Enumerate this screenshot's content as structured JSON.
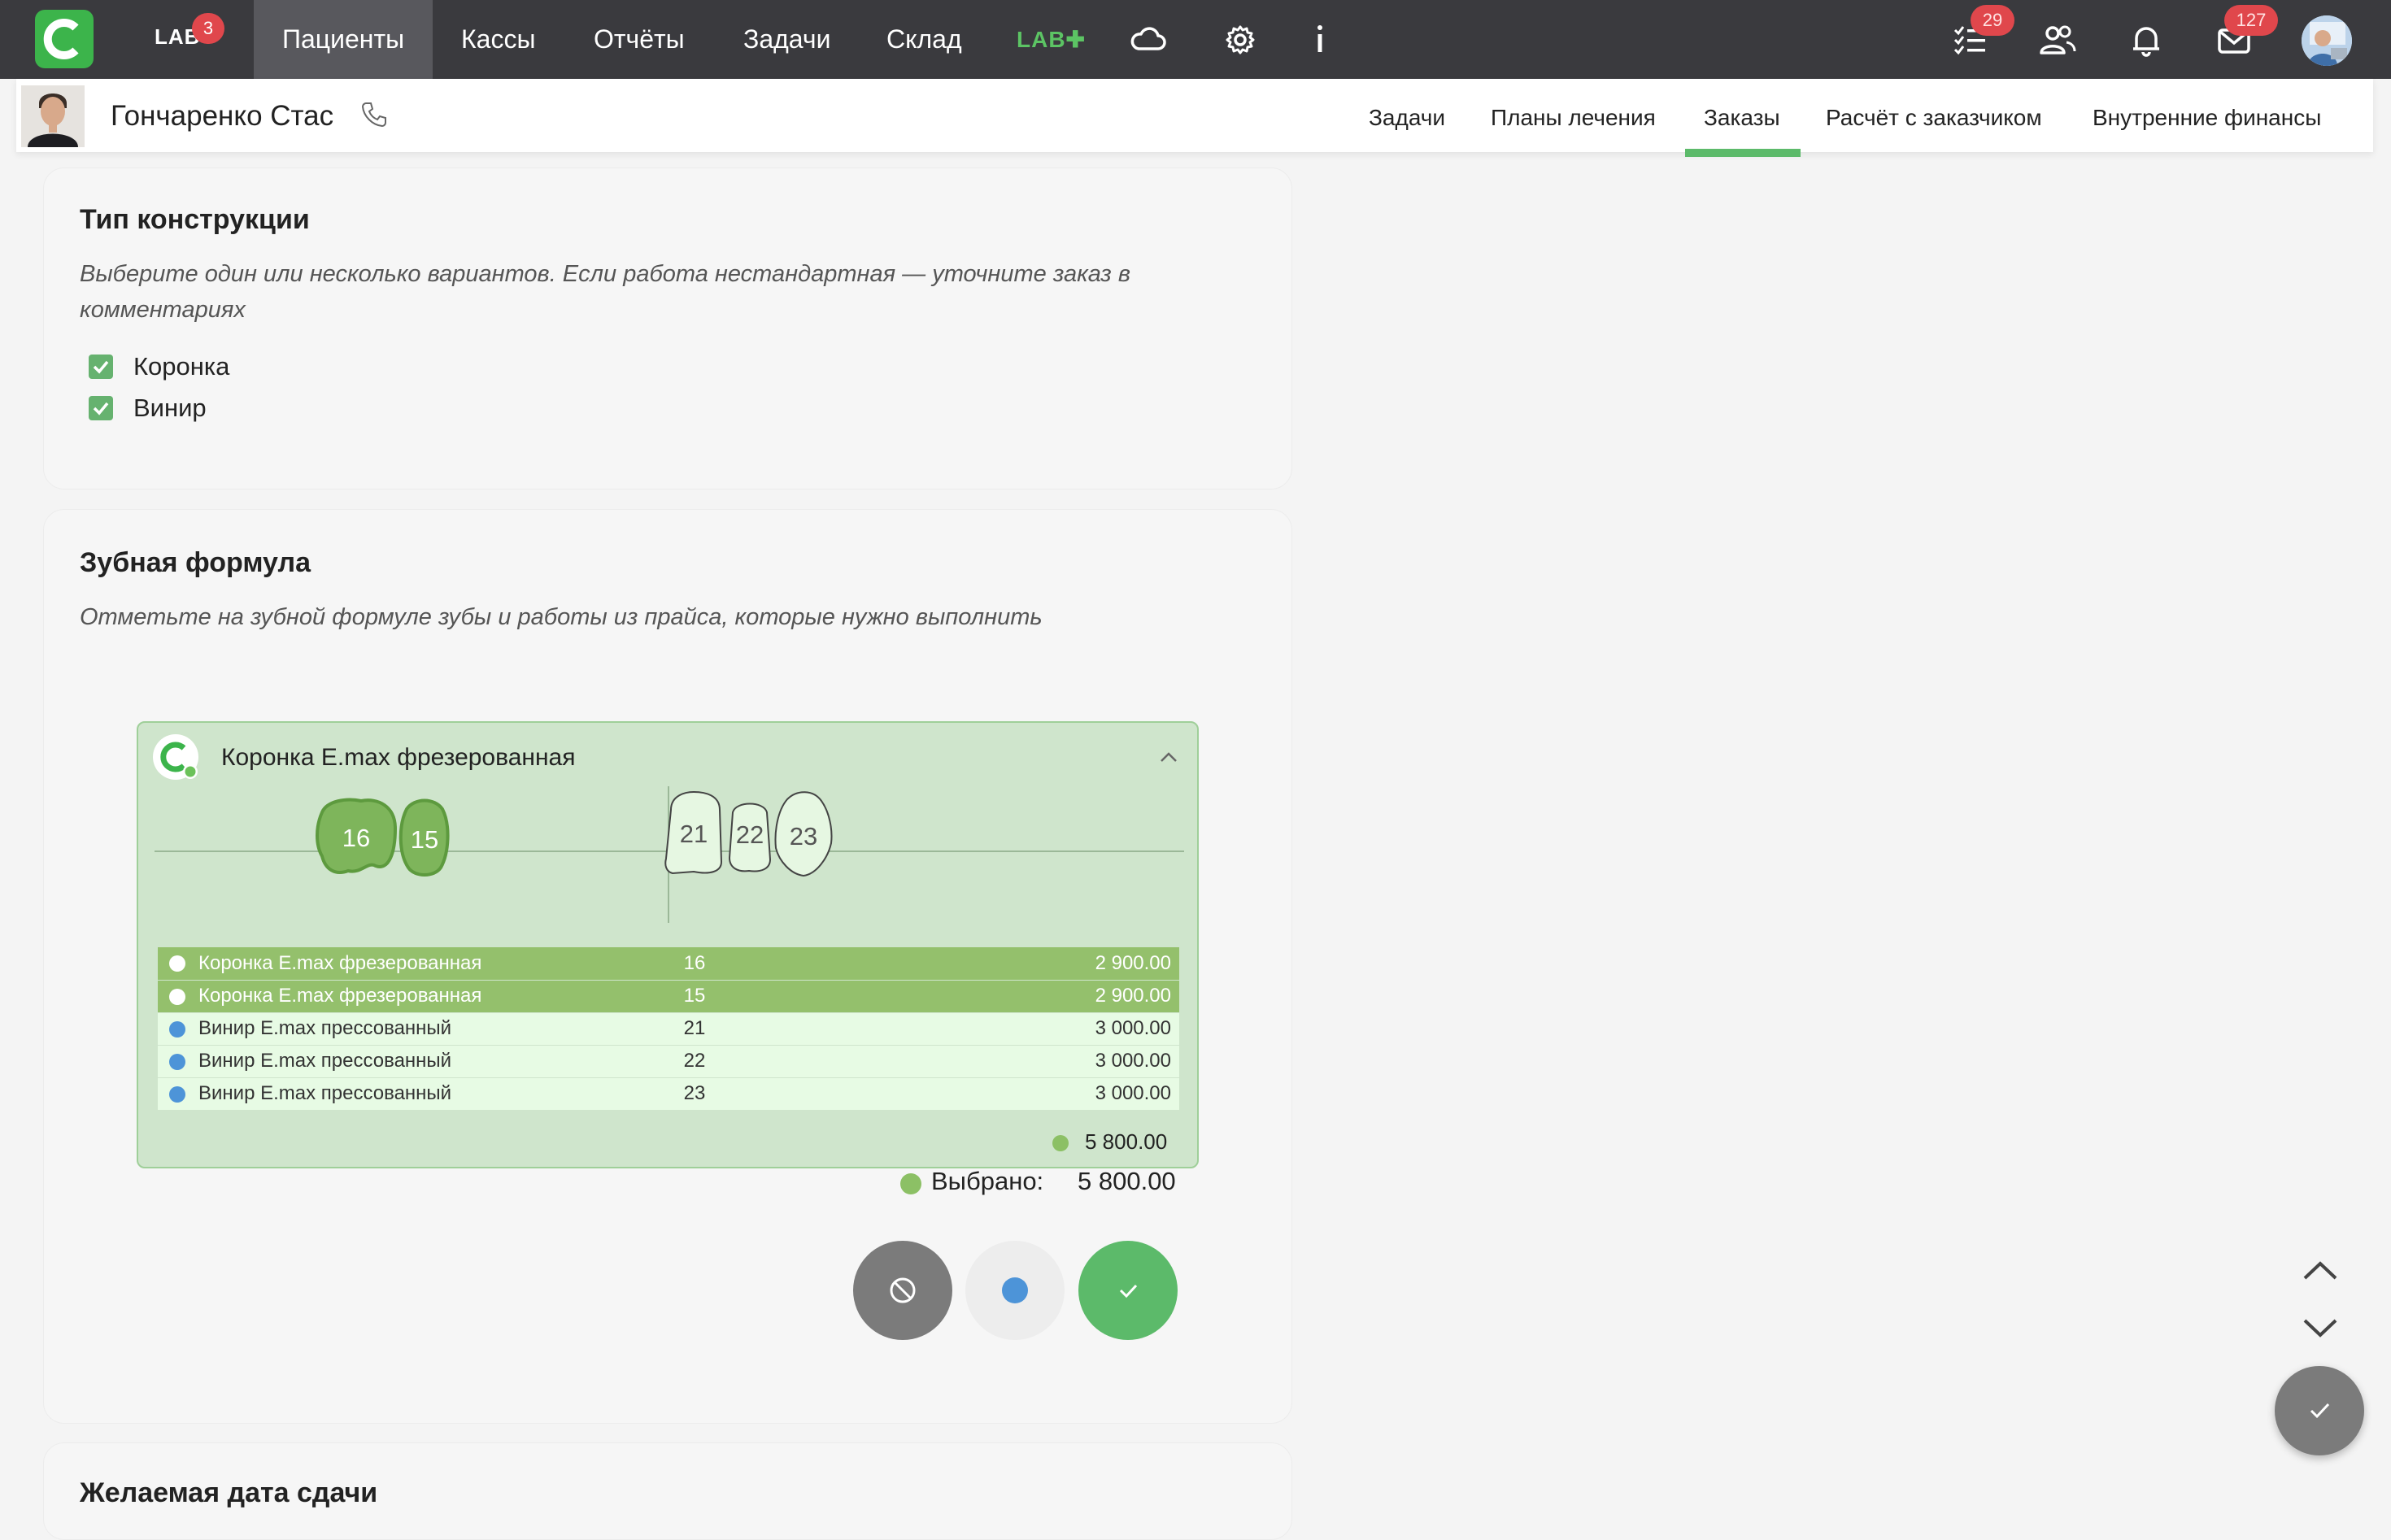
{
  "nav": {
    "lab_label": "LAB",
    "lab_badge": "3",
    "items": [
      "Пациенты",
      "Кассы",
      "Отчёты",
      "Задачи",
      "Склад"
    ],
    "active_item": "Пациенты",
    "labplus_label": "LAB✚",
    "tasks_badge": "29",
    "messages_badge": "127",
    "icons": [
      "cloud-icon",
      "gear-icon",
      "info-icon",
      "checklist-icon",
      "users-icon",
      "bell-icon",
      "mail-icon"
    ]
  },
  "patient": {
    "name": "Гончаренко Стас",
    "tabs": [
      "Задачи",
      "Планы лечения",
      "Заказы",
      "Расчёт с заказчиком",
      "Внутренние финансы"
    ],
    "active_tab": "Заказы"
  },
  "construction": {
    "title": "Тип конструкции",
    "description": "Выберите один или несколько вариантов. Если работа нестандартная — уточните заказ в комментариях",
    "options": [
      {
        "label": "Коронка",
        "checked": true
      },
      {
        "label": "Винир",
        "checked": true
      }
    ]
  },
  "formula": {
    "title": "Зубная формула",
    "description": "Отметьте на зубной формуле зубы и работы из прайса, которые нужно выполнить",
    "panel_title": "Коронка E.max фрезерованная",
    "teeth": [
      {
        "number": "16",
        "selected": true
      },
      {
        "number": "15",
        "selected": true
      },
      {
        "number": "21",
        "selected": false
      },
      {
        "number": "22",
        "selected": false
      },
      {
        "number": "23",
        "selected": false
      }
    ],
    "rows": [
      {
        "name": "Коронка E.max фрезерованная",
        "tooth": "16",
        "price": "2 900.00",
        "selected": true
      },
      {
        "name": "Коронка E.max фрезерованная",
        "tooth": "15",
        "price": "2 900.00",
        "selected": true
      },
      {
        "name": "Винир E.max прессованный",
        "tooth": "21",
        "price": "3 000.00",
        "selected": false
      },
      {
        "name": "Винир E.max прессованный",
        "tooth": "22",
        "price": "3 000.00",
        "selected": false
      },
      {
        "name": "Винир E.max прессованный",
        "tooth": "23",
        "price": "3 000.00",
        "selected": false
      }
    ],
    "panel_total": "5 800.00",
    "selected_label": "Выбрано:",
    "selected_value": "5 800.00"
  },
  "next_section": {
    "title": "Желаемая дата сдачи"
  },
  "colors": {
    "accent_green": "#5cba6a",
    "selected_green": "#94c06c",
    "blue_dot": "#4d94d8",
    "nav_bg": "#3a3a3e",
    "badge_red": "#e0474c"
  }
}
